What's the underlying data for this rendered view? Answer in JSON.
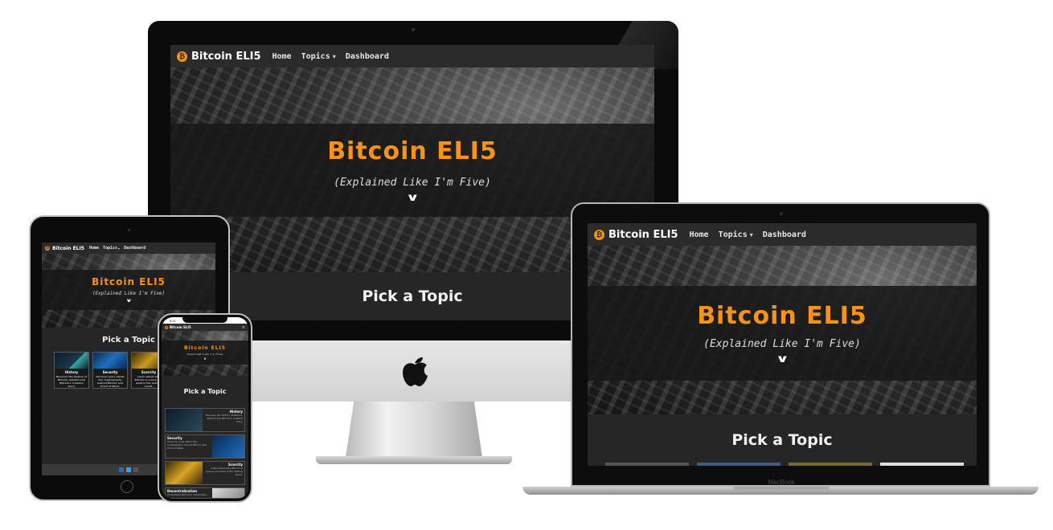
{
  "site": {
    "brand": "Bitcoin ELI5",
    "logo_glyph": "₿",
    "nav": {
      "home": "Home",
      "topics": "Topics",
      "dashboard": "Dashboard"
    },
    "dropdown_caret": "▾",
    "hero_title": "Bitcoin ELI5",
    "hero_subtitle": "(Explained Like I'm Five)",
    "scroll_icon": "chevron-down-icon",
    "section_heading": "Pick a Topic",
    "accent_color": "#f7931a"
  },
  "ipad": {
    "topics": [
      {
        "title": "History",
        "text": "Discover the history of Bitcoin, Satoshi and Bitcoin's creation story."
      },
      {
        "title": "Security",
        "text": "Discover more about the cryptography behind Bitcoin and Proof of Work."
      },
      {
        "title": "Scarcity",
        "text": "Learn about why Bitcoin is scarce and what is the halving event."
      }
    ],
    "footer_icons": [
      "facebook-icon",
      "twitter-icon",
      "github-icon"
    ]
  },
  "iphone": {
    "status_time": "9:41",
    "brand": "Bitcoin ELI5",
    "menu_icon": "hamburger-icon",
    "hero_title": "Bitcoin ELI5",
    "hero_subtitle": "(Explained Like I'm Five)",
    "section_heading": "Pick a Topic",
    "topics": [
      {
        "title": "History",
        "text": "Discover the history of Bitcoin, Satoshi and Bitcoin's creation story."
      },
      {
        "title": "Security",
        "text": "Discover more about the cryptography behind Bitcoin and Proof of Work."
      },
      {
        "title": "Scarcity",
        "text": "Learn about why Bitcoin is scarce and what is the halving event."
      },
      {
        "title": "Decentralization",
        "text": "Understand Bitcoin's censorship..."
      }
    ]
  },
  "macbook": {
    "label": "MacBook"
  }
}
